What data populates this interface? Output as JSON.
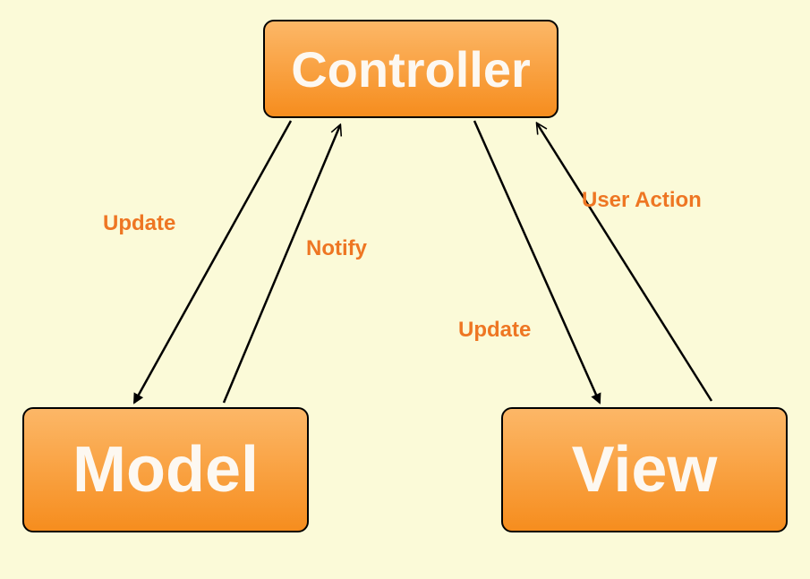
{
  "diagram": {
    "nodes": {
      "controller": {
        "label": "Controller"
      },
      "model": {
        "label": "Model"
      },
      "view": {
        "label": "View"
      }
    },
    "edges": {
      "controller_to_model": {
        "label": "Update",
        "from": "controller",
        "to": "model",
        "arrow": "solid"
      },
      "model_to_controller": {
        "label": "Notify",
        "from": "model",
        "to": "controller",
        "arrow": "open"
      },
      "controller_to_view": {
        "label": "Update",
        "from": "controller",
        "to": "view",
        "arrow": "solid"
      },
      "view_to_controller": {
        "label": "User Action",
        "from": "view",
        "to": "controller",
        "arrow": "open"
      }
    },
    "colors": {
      "background": "#fbfad8",
      "node_gradient_top": "#fcb767",
      "node_gradient_bottom": "#f68d1e",
      "node_text": "#fdf8f1",
      "label_text": "#ee7623",
      "arrow": "#000000"
    }
  }
}
